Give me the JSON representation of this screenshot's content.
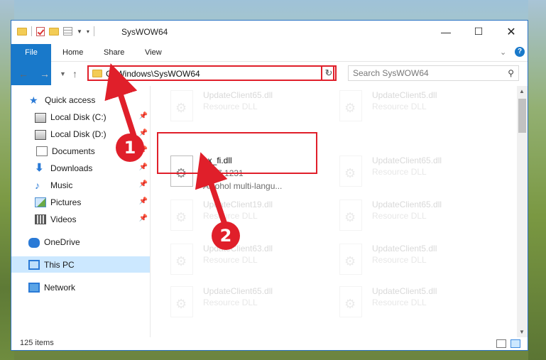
{
  "window": {
    "title": "SysWOW64"
  },
  "ribbon": {
    "tabs": [
      "File",
      "Home",
      "Share",
      "View"
    ]
  },
  "address": {
    "path": "C:\\Windows\\SysWOW64"
  },
  "search": {
    "placeholder": "Search SysWOW64"
  },
  "nav": {
    "items": [
      {
        "label": "Quick access",
        "icon": "star-icon"
      },
      {
        "label": "Local Disk (C:)",
        "icon": "disk-icon"
      },
      {
        "label": "Local Disk (D:)",
        "icon": "disk-icon"
      },
      {
        "label": "Documents",
        "icon": "documents-icon"
      },
      {
        "label": "Downloads",
        "icon": "downloads-icon"
      },
      {
        "label": "Music",
        "icon": "music-icon"
      },
      {
        "label": "Pictures",
        "icon": "pictures-icon"
      },
      {
        "label": "Videos",
        "icon": "videos-icon"
      },
      {
        "label": "OneDrive",
        "icon": "onedrive-icon"
      },
      {
        "label": "This PC",
        "icon": "pc-icon"
      },
      {
        "label": "Network",
        "icon": "network-icon"
      }
    ]
  },
  "files": [
    {
      "name": "UpdateClient65.dll",
      "type": "Resource DLL"
    },
    {
      "name": "UpdateClient5.dll",
      "type": "Resource DLL"
    },
    {
      "name": "ax_fi.dll",
      "version": "1.3.7.1231",
      "description": "Alcohol multi-langu..."
    },
    {
      "name": "UpdateClient65.dll",
      "type": "Resource DLL"
    },
    {
      "name": "UpdateClient19.dll",
      "type": "Resource DLL"
    },
    {
      "name": "UpdateClient65.dll",
      "type": "Resource DLL"
    },
    {
      "name": "UpdateClient63.dll",
      "type": "Resource DLL"
    },
    {
      "name": "UpdateClient5.dll",
      "type": "Resource DLL"
    },
    {
      "name": "UpdateClient65.dll",
      "type": "Resource DLL"
    },
    {
      "name": "UpdateClient5.dll",
      "type": "Resource DLL"
    }
  ],
  "status": {
    "items": "125 items"
  },
  "annotations": {
    "badge1": "1",
    "badge2": "2",
    "color": "#e01f2a"
  }
}
